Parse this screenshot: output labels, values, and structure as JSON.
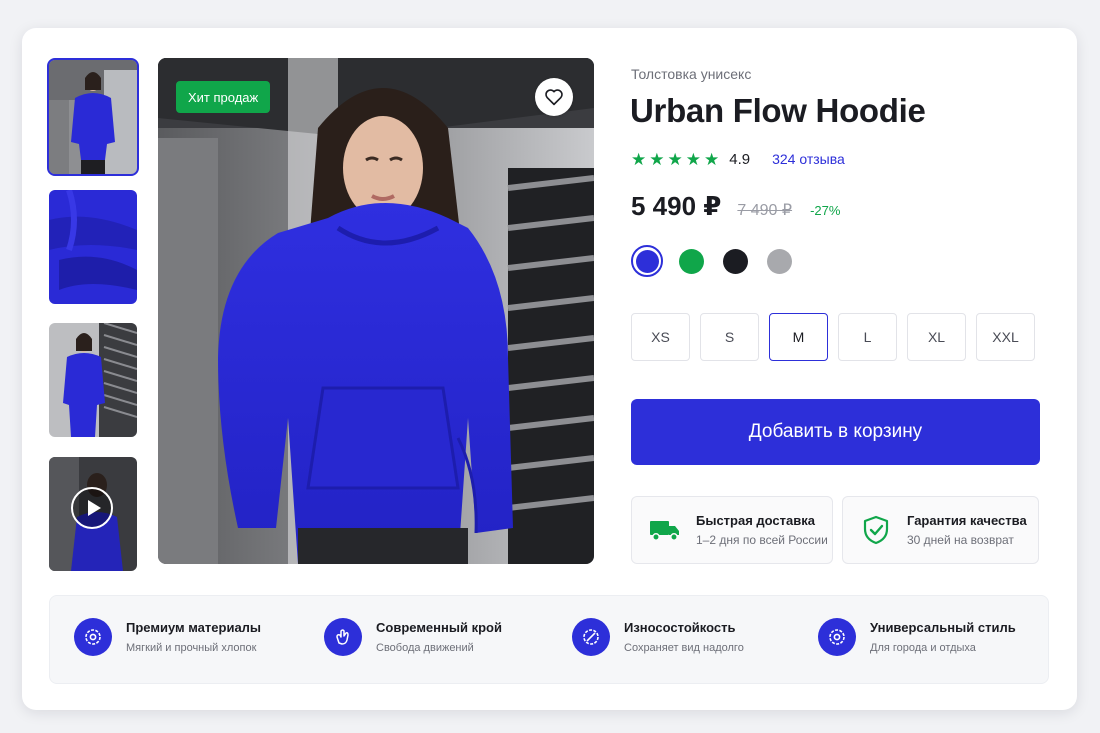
{
  "gallery": {
    "thumbnails": [
      {
        "name": "thumb-model-front",
        "type": "photo"
      },
      {
        "name": "thumb-fabric-closeup",
        "type": "photo"
      },
      {
        "name": "thumb-model-side",
        "type": "photo"
      },
      {
        "name": "thumb-video",
        "type": "video",
        "icon": "play-icon"
      }
    ],
    "badge": "Хит продаж",
    "favorite_icon": "heart-icon"
  },
  "product": {
    "category": "Толстовка унисекс",
    "title": "Urban Flow Hoodie",
    "rating": {
      "stars": 5,
      "value": "4.9",
      "reviews": "324 отзыва"
    },
    "price": {
      "current": "5 490 ₽",
      "old": "7 490 ₽",
      "discount": "-27%"
    },
    "colors": [
      {
        "hex": "#2d2fd9",
        "selected": true
      },
      {
        "hex": "#10a64a",
        "selected": false
      },
      {
        "hex": "#1b1c22",
        "selected": false
      },
      {
        "hex": "#a8a9ad",
        "selected": false
      }
    ],
    "sizes": [
      "XS",
      "S",
      "M",
      "L",
      "XL",
      "XXL"
    ],
    "selected_size": "M",
    "add_to_cart": "Добавить в корзину"
  },
  "perks": [
    {
      "icon": "truck-icon",
      "title": "Быстрая доставка",
      "subtitle": "1–2 дня по всей России"
    },
    {
      "icon": "shield-check-icon",
      "title": "Гарантия качества",
      "subtitle": "30 дней на возврат"
    }
  ],
  "features": [
    {
      "icon": "badge-gear-icon",
      "title": "Премиум материалы",
      "subtitle": "Мягкий и прочный хлопок"
    },
    {
      "icon": "hand-icon",
      "title": "Современный крой",
      "subtitle": "Свобода движений"
    },
    {
      "icon": "durable-badge-icon",
      "title": "Износостойкость",
      "subtitle": "Сохраняет вид надолго"
    },
    {
      "icon": "style-gear-icon",
      "title": "Универсальный стиль",
      "subtitle": "Для города и отдыха"
    }
  ],
  "colors": {
    "accent": "#2d2fd9",
    "success": "#10a64a",
    "text": "#1b1c22",
    "muted": "#6d6f78"
  }
}
